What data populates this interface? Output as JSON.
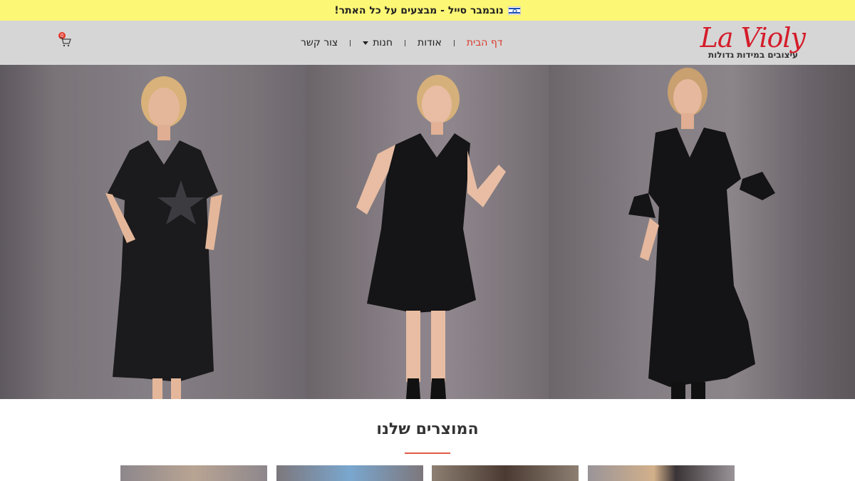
{
  "promo": {
    "text": "נובמבר סייל - מבצעים על כל האתר!",
    "flag_icon": "israel-flag-icon"
  },
  "header": {
    "logo_script": "La Violy",
    "logo_tagline": "עיצובים במידות גדולות",
    "nav": [
      {
        "label": "דף הבית",
        "active": true
      },
      {
        "label": "אודות",
        "active": false
      },
      {
        "label": "חנות",
        "active": false,
        "has_dropdown": true
      },
      {
        "label": "צור קשר",
        "active": false
      }
    ],
    "cart_count": "0",
    "cart_icon": "shopping-cart-icon"
  },
  "colors": {
    "promo_bg": "#fdf776",
    "header_bg": "#d6d6d6",
    "accent_red": "#d93a2b",
    "logo_red": "#d41c2a"
  },
  "products_section": {
    "title": "המוצרים שלנו"
  }
}
